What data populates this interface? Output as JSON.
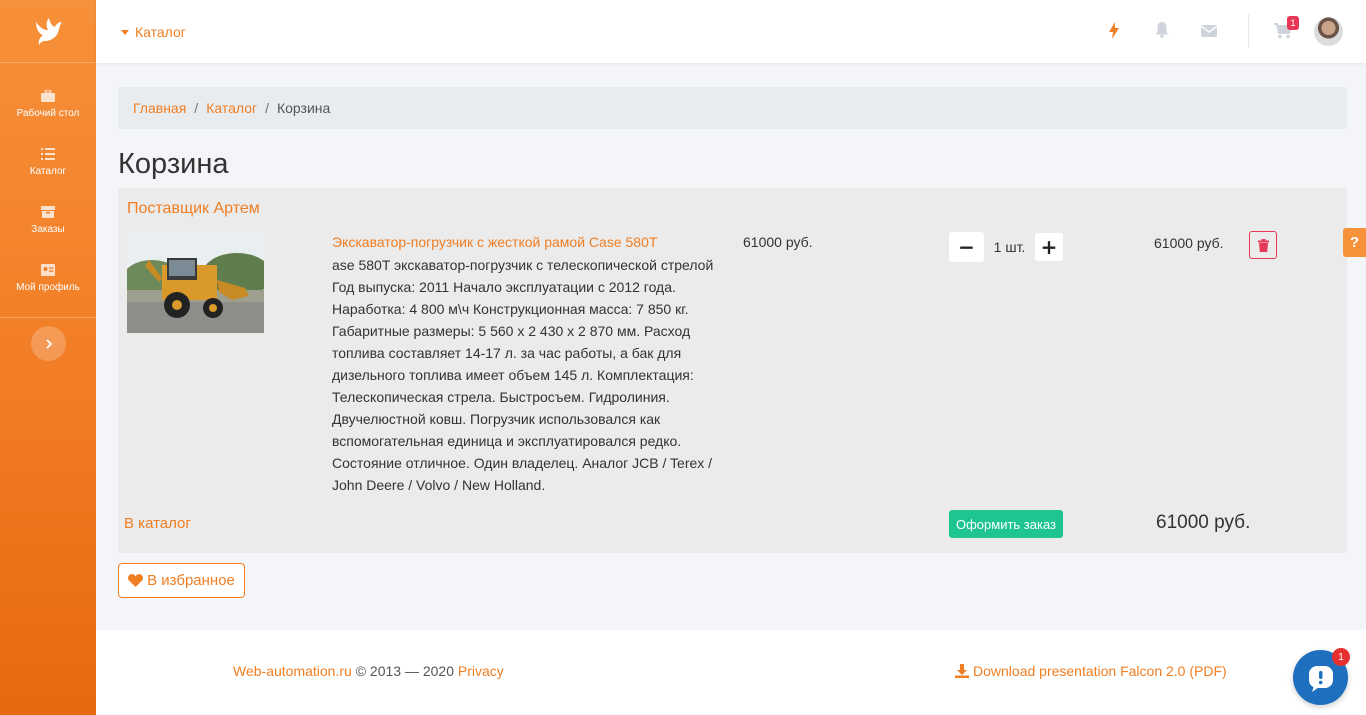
{
  "sidebar": {
    "logo_icon": "bird-logo",
    "items": [
      {
        "label": "Рабочий стол",
        "icon": "briefcase-icon"
      },
      {
        "label": "Каталог",
        "icon": "list-icon"
      },
      {
        "label": "Заказы",
        "icon": "box-icon"
      },
      {
        "label": "Мой профиль",
        "icon": "id-card-icon"
      }
    ],
    "expand_icon": "chevron-right-icon"
  },
  "topbar": {
    "catalog_label": "Каталог",
    "icons": [
      "bolt-icon",
      "bell-icon",
      "envelope-icon",
      "cart-icon"
    ],
    "cart_count": "1"
  },
  "breadcrumb": {
    "items": [
      "Главная",
      "Каталог"
    ],
    "current": "Корзина"
  },
  "page_title": "Корзина",
  "cart": {
    "supplier": "Поставщик Артем",
    "product": {
      "title": "Экскаватор-погрузчик с жесткой рамой Case 580T",
      "description": "ase 580T экскаватор-погрузчик с телескопической стрелой Год выпуска: 2011 Начало эксплуатации с 2012 года. Наработка: 4 800 м\\ч Конструкционная масса: 7 850 кг. Габаритные размеры: 5 560 х 2 430 х 2 870 мм. Расход топлива составляет 14-17 л. за час работы, а бак для дизельного топлива имеет объем 145 л. Комплектация: Телескопическая стрела. Быстросъем. Гидролиния. Двучелюстной ковш. Погрузчик использовался как вспомогательная единица и эксплуатировался редко. Состояние отличное. Один владелец. Аналог JCB / Terex / John Deere / Volvo / New Holland.",
      "unit_price": "61000 руб.",
      "quantity": "1 шт.",
      "minus": "−",
      "plus": "+",
      "line_total": "61000 руб."
    },
    "to_catalog": "В каталог",
    "checkout": "Оформить заказ",
    "total": "61000 руб."
  },
  "favorites_label": "В избранное",
  "footer": {
    "site": "Web-automation.ru",
    "copyright": " © 2013 — 2020 ",
    "privacy": "Privacy",
    "download": "Download presentation Falcon 2.0 (PDF)"
  },
  "help_label": "?",
  "chat_badge": "1",
  "colors": {
    "accent": "#f07e23",
    "success": "#1fc591",
    "danger": "#e63757"
  }
}
